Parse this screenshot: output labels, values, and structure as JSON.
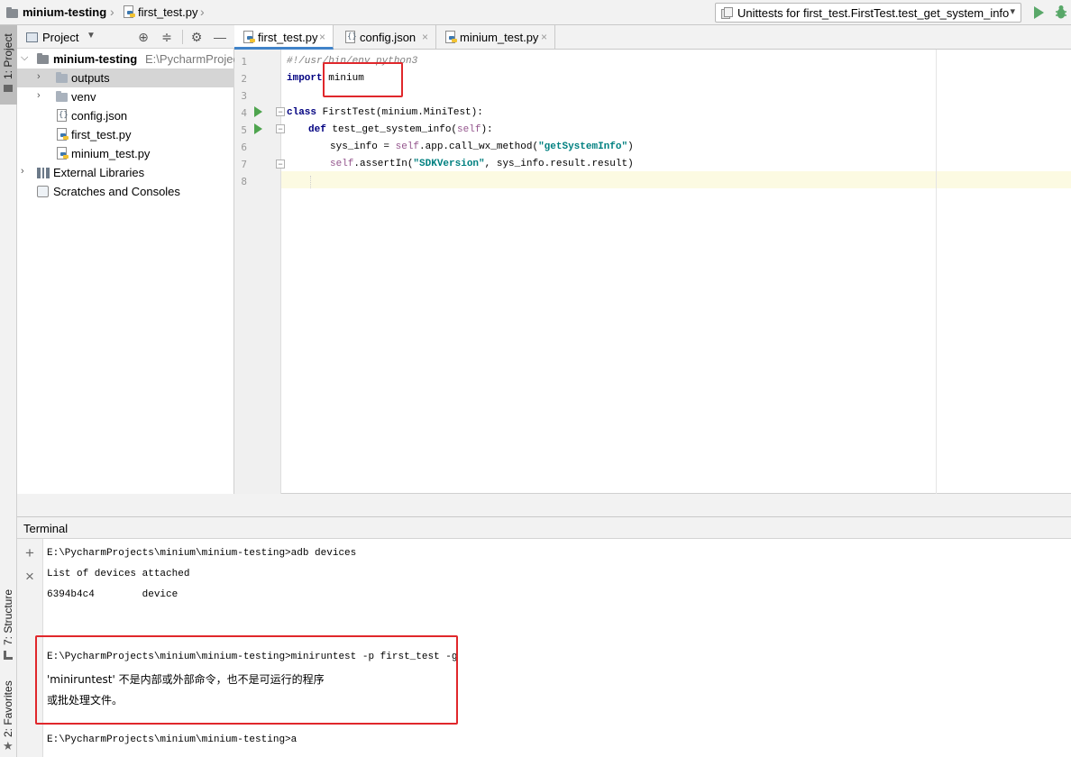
{
  "navbar": {
    "project_name": "minium-testing",
    "file_name": "first_test.py",
    "run_config_label": "Unittests for first_test.FirstTest.test_get_system_info"
  },
  "left_strip": {
    "project_tab": "1: Project",
    "structure_tab": "7: Structure",
    "favorites_tab": "2: Favorites"
  },
  "project_panel": {
    "title": "Project",
    "root_name": "minium-testing",
    "root_path": "E:\\PycharmProjec",
    "items": [
      {
        "label": "outputs"
      },
      {
        "label": "venv"
      },
      {
        "label": "config.json"
      },
      {
        "label": "first_test.py"
      },
      {
        "label": "minium_test.py"
      },
      {
        "label": "External Libraries"
      },
      {
        "label": "Scratches and Consoles"
      }
    ]
  },
  "editor": {
    "tabs": [
      {
        "label": "first_test.py"
      },
      {
        "label": "config.json"
      },
      {
        "label": "minium_test.py"
      }
    ],
    "line_numbers": [
      "1",
      "2",
      "3",
      "4",
      "5",
      "6",
      "7",
      "8"
    ],
    "code": {
      "l1": "#!/usr/bin/env python3",
      "l2_kw": "import",
      "l2_rest": " minium",
      "l4_kw": "class",
      "l4_rest": " FirstTest(minium.MiniTest):",
      "l5_kw": "def",
      "l5_name": " test_get_system_info(",
      "l5_self": "self",
      "l5_end": "):",
      "l6_a": "sys_info = ",
      "l6_self": "self",
      "l6_b": ".app.call_wx_method(",
      "l6_str": "\"getSystemInfo\"",
      "l6_end": ")",
      "l7_self": "self",
      "l7_a": ".assertIn(",
      "l7_str": "\"SDKVersion\"",
      "l7_end": ", sys_info.result.result)"
    }
  },
  "terminal": {
    "title": "Terminal",
    "lines": {
      "t1": "E:\\PycharmProjects\\minium\\minium-testing>adb devices",
      "t2": "List of devices attached",
      "t3": "6394b4c4        device",
      "t4": "E:\\PycharmProjects\\minium\\minium-testing>miniruntest -p first_test -g",
      "t5": "'miniruntest' 不是内部或外部命令，也不是可运行的程序",
      "t6": "或批处理文件。",
      "t7": "E:\\PycharmProjects\\minium\\minium-testing>a"
    }
  },
  "colors": {
    "highlight_box": "#e0272b",
    "run_green": "#59a869",
    "active_tab_underline": "#4083c9",
    "current_line": "#fcfae2"
  }
}
